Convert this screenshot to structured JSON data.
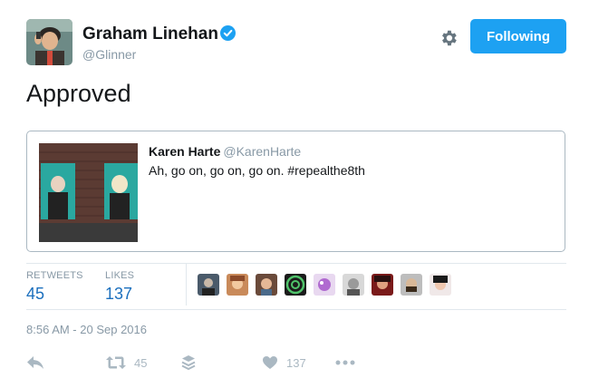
{
  "author": {
    "display_name": "Graham Linehan",
    "handle": "@Glinner",
    "avatar_icon": "user-avatar",
    "verified_icon": "verified-badge-icon"
  },
  "header": {
    "settings_icon": "gear-icon",
    "follow_button_label": "Following"
  },
  "tweet": {
    "text": "Approved"
  },
  "quoted_tweet": {
    "display_name": "Karen Harte",
    "handle": "@KarenHarte",
    "text": "Ah, go on, go on, go on. #repealthe8th",
    "media_icon": "photo-thumbnail"
  },
  "stats": {
    "retweets_label": "RETWEETS",
    "retweets_count": "45",
    "likes_label": "LIKES",
    "likes_count": "137"
  },
  "timestamp": "8:56 AM - 20 Sep 2016",
  "actions": {
    "reply_icon": "reply-icon",
    "retweet_icon": "retweet-icon",
    "retweet_count": "45",
    "stack_icon": "layers-icon",
    "like_icon": "heart-icon",
    "like_count": "137",
    "more_icon": "more-dots-icon"
  },
  "colors": {
    "accent": "#1da1f2",
    "stat_blue": "#1b6fbd",
    "muted": "#8899a6"
  }
}
